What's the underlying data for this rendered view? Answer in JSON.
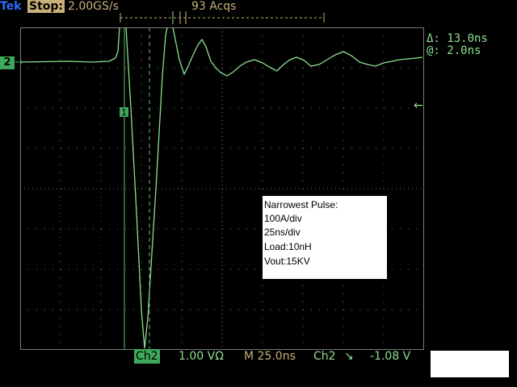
{
  "header": {
    "brand": "Tek",
    "run_state": "Stop:",
    "sample_rate": "2.00GS/s",
    "acquisitions": "93 Acqs"
  },
  "measurements": {
    "delta": "Δ: 13.0ns",
    "at": "@: 2.0ns"
  },
  "channel_marker": "2",
  "footer": {
    "channel": "Ch2",
    "volts_per_div": "1.00 VΩ",
    "time_per_div": "M 25.0ns",
    "trigger_source": "Ch2",
    "trigger_slope_symbol": "↘",
    "trigger_level": "-1.08 V"
  },
  "annotation": {
    "lines": [
      "Narrowest Pulse:",
      "100A/div",
      "25ns/div",
      "Load:10nH",
      "Vout:15KV"
    ]
  },
  "colors": {
    "trace": "#8fe08f",
    "cursor": "#5fbf6f",
    "grid": "#7a7a7a",
    "accent_brand": "#2b6bff",
    "accent_stop": "#c8b07a"
  },
  "cursor_label": "1"
}
